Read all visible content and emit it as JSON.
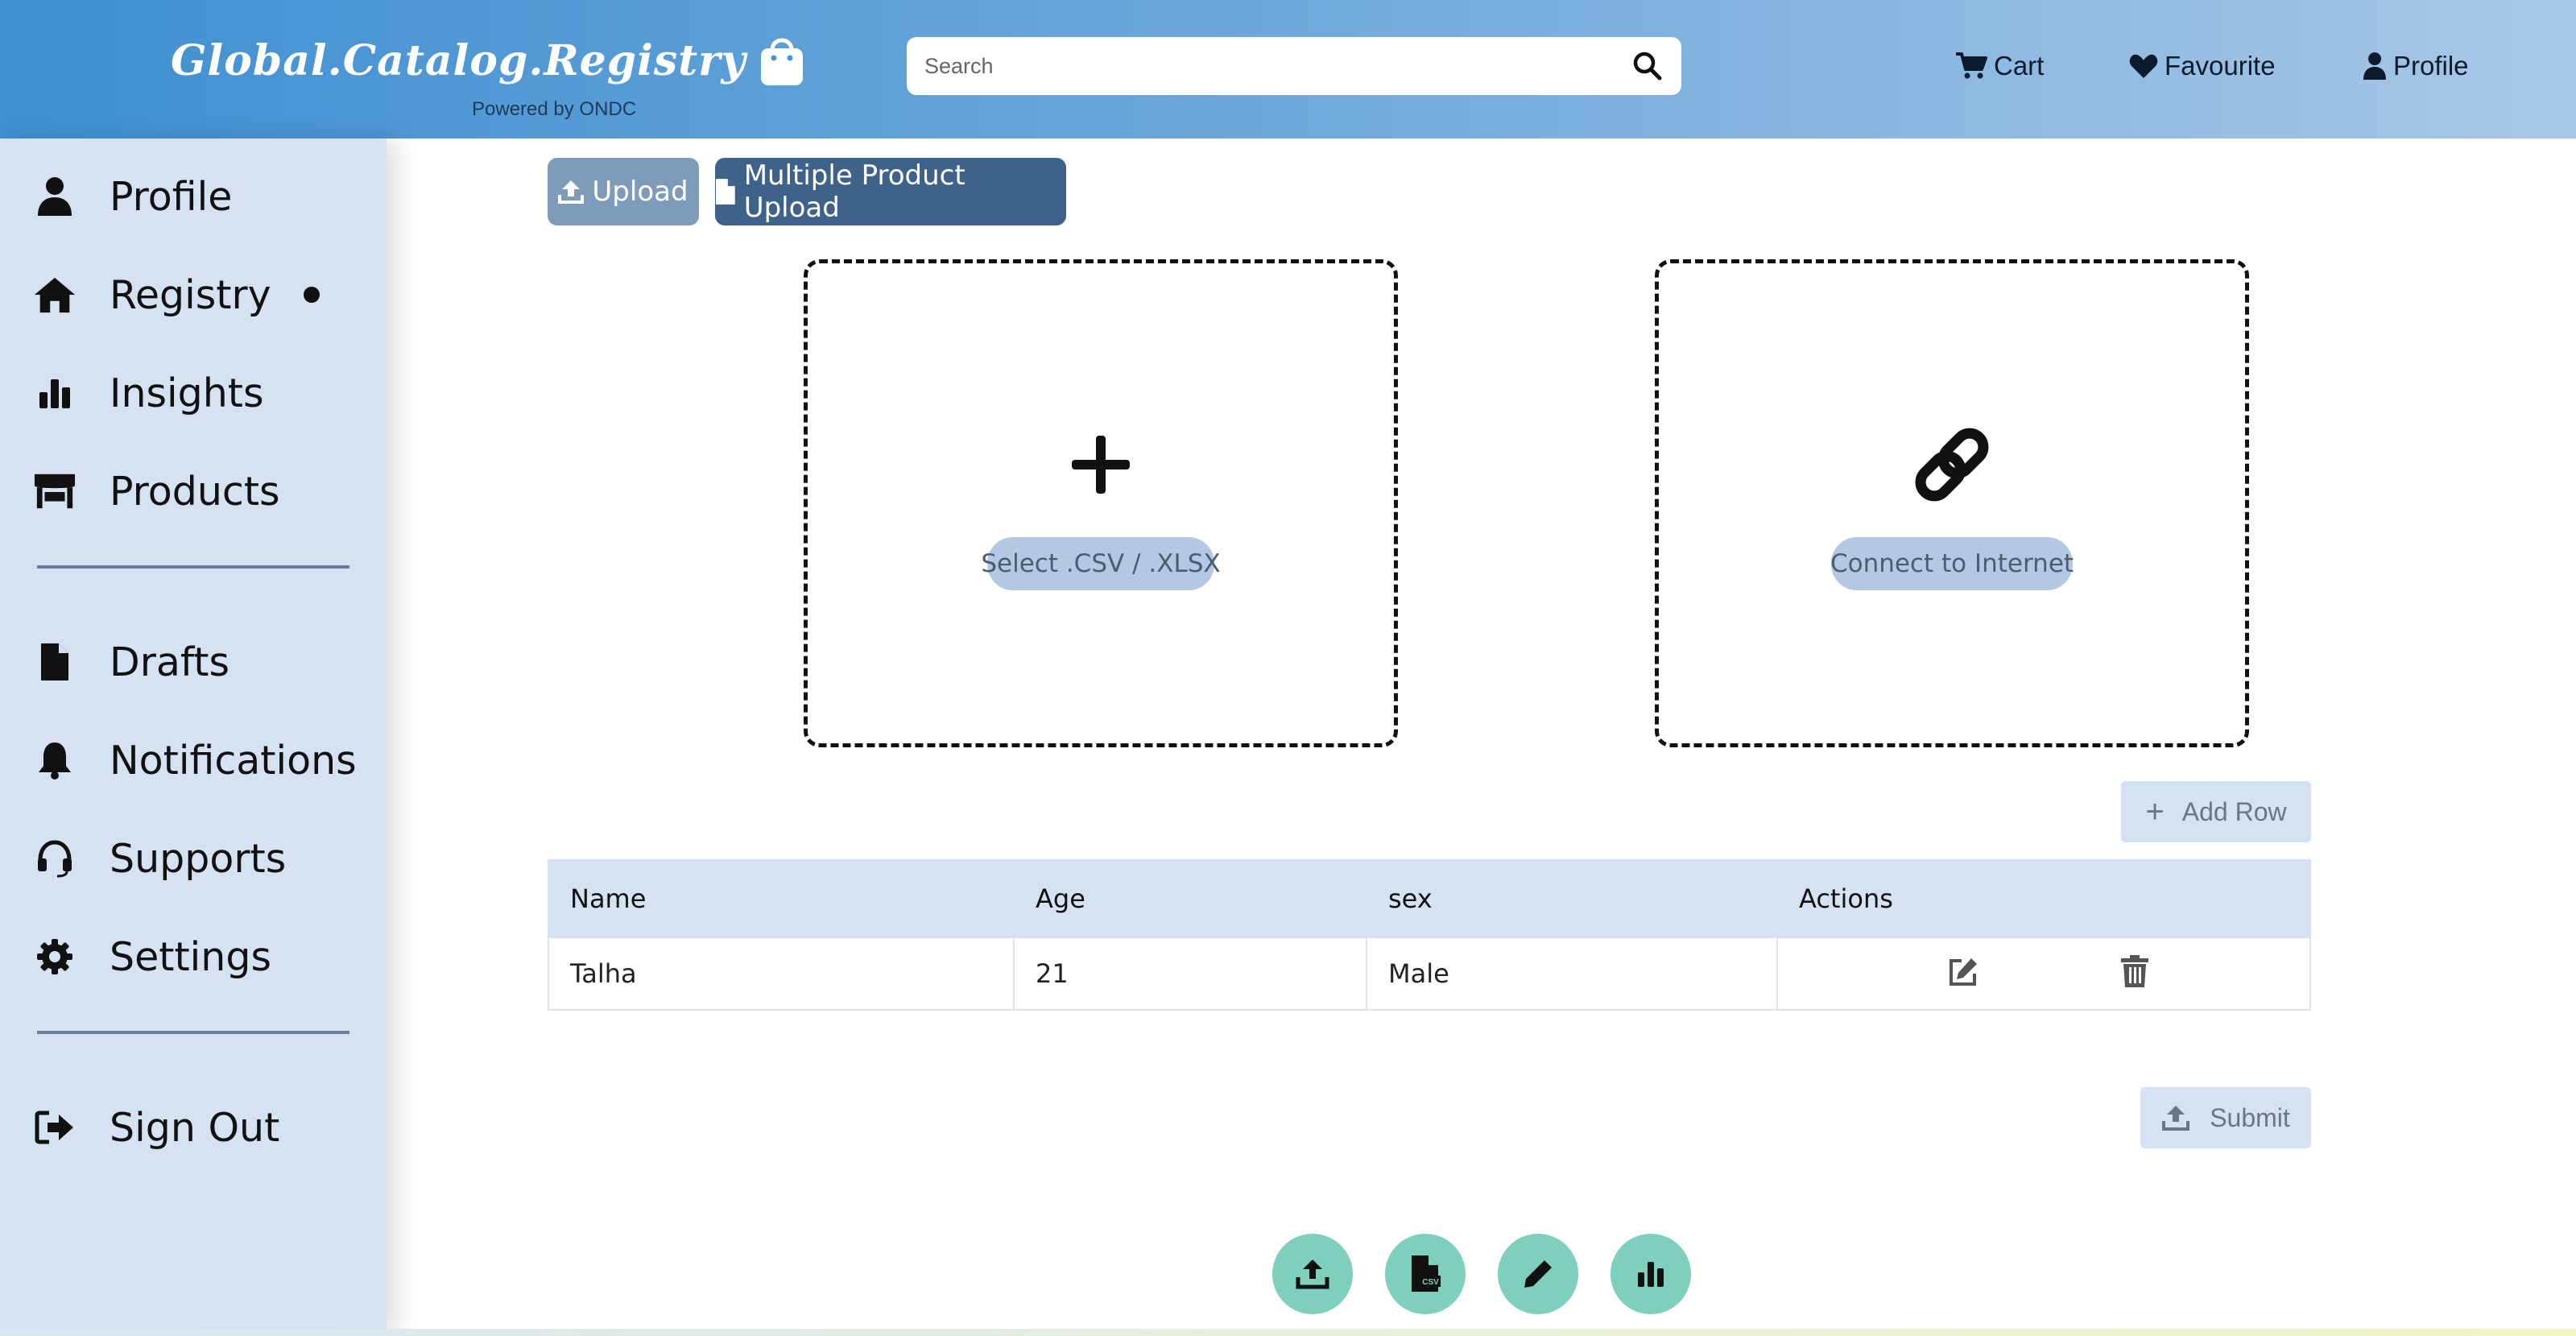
{
  "header": {
    "logo_text": "Global.Catalog.Registry",
    "logo_sub": "Powered by ONDC",
    "search_placeholder": "Search",
    "search_icon": "search-icon",
    "nav": [
      {
        "label": "Cart",
        "icon": "cart-icon"
      },
      {
        "label": "Favourite",
        "icon": "heart-icon"
      },
      {
        "label": "Profile",
        "icon": "user-icon"
      }
    ]
  },
  "sidebar": {
    "items": [
      {
        "label": "Profile",
        "icon": "user-icon"
      },
      {
        "label": "Registry",
        "icon": "home-icon",
        "active": true
      },
      {
        "label": "Insights",
        "icon": "bar-chart-icon"
      },
      {
        "label": "Products",
        "icon": "store-icon"
      },
      {
        "label": "Drafts",
        "icon": "file-icon"
      },
      {
        "label": "Notifications",
        "icon": "bell-icon"
      },
      {
        "label": "Supports",
        "icon": "headset-icon"
      },
      {
        "label": "Settings",
        "icon": "gear-icon"
      },
      {
        "label": "Sign Out",
        "icon": "sign-out-icon"
      }
    ]
  },
  "toolbar": {
    "upload_label": "Upload",
    "multi_upload_label": "Multiple Product Upload"
  },
  "drop_zones": [
    {
      "label": "Select .CSV / .XLSX",
      "icon": "plus-icon"
    },
    {
      "label": "Connect to Internet",
      "icon": "link-icon"
    }
  ],
  "add_row_label": "Add Row",
  "table": {
    "headers": [
      "Name",
      "Age",
      "sex",
      "Actions"
    ],
    "rows": [
      {
        "name": "Talha",
        "age": "21",
        "sex": "Male"
      }
    ]
  },
  "submit_label": "Submit",
  "fabs": [
    "upload-icon",
    "csv-file-icon",
    "pencil-icon",
    "bar-chart-icon"
  ],
  "colors": {
    "header_start": "#3f8fd1",
    "header_end": "#a8c7e6",
    "sidebar_bg": "#d4e2f1",
    "primary_button": "#3f6289",
    "upload_button": "#7f9bba",
    "fab": "#7fcfbd"
  }
}
